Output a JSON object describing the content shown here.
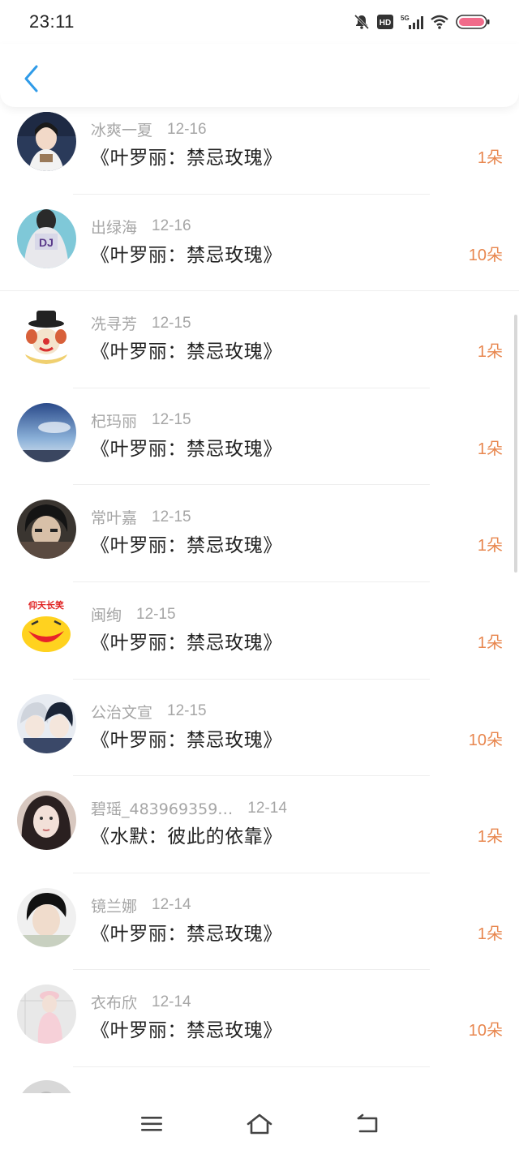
{
  "status_bar": {
    "time": "23:11",
    "hd": "HD",
    "signal": "5G"
  },
  "nav": {
    "back_icon": "chevron-left-icon"
  },
  "gifts": [
    {
      "name": "冰爽一夏",
      "date": "12-16",
      "title": "《叶罗丽：禁忌玫瑰》",
      "count": "1朵"
    },
    {
      "name": "出绿海",
      "date": "12-16",
      "title": "《叶罗丽：禁忌玫瑰》",
      "count": "10朵"
    },
    {
      "name": "冼寻芳",
      "date": "12-15",
      "title": "《叶罗丽：禁忌玫瑰》",
      "count": "1朵"
    },
    {
      "name": "杞玛丽",
      "date": "12-15",
      "title": "《叶罗丽：禁忌玫瑰》",
      "count": "1朵"
    },
    {
      "name": "常叶嘉",
      "date": "12-15",
      "title": "《叶罗丽：禁忌玫瑰》",
      "count": "1朵"
    },
    {
      "name": "闽绚",
      "date": "12-15",
      "title": "《叶罗丽：禁忌玫瑰》",
      "count": "1朵"
    },
    {
      "name": "公治文宣",
      "date": "12-15",
      "title": "《叶罗丽：禁忌玫瑰》",
      "count": "10朵"
    },
    {
      "name": "碧瑶_483969359…",
      "date": "12-14",
      "title": "《水默：彼此的依靠》",
      "count": "1朵"
    },
    {
      "name": "镜兰娜",
      "date": "12-14",
      "title": "《叶罗丽：禁忌玫瑰》",
      "count": "1朵"
    },
    {
      "name": "衣布欣",
      "date": "12-14",
      "title": "《叶罗丽：禁忌玫瑰》",
      "count": "10朵"
    }
  ],
  "avatar_badges": {
    "row5": "仰天长笑"
  },
  "colors": {
    "accent": "#e8874f",
    "back": "#2f9be8",
    "muted": "#a6a6a6",
    "text": "#222222"
  },
  "bottom_nav": {
    "menu": "menu-icon",
    "home": "home-icon",
    "back": "back-icon"
  }
}
